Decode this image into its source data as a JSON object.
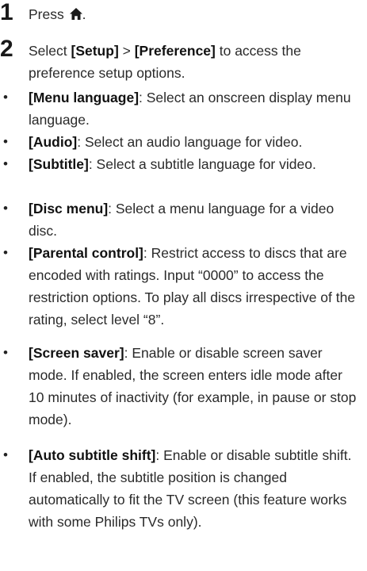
{
  "steps": [
    {
      "number": "1",
      "text": "Press",
      "icon": "home-icon",
      "text_after": "."
    },
    {
      "number": "2",
      "before": "Select ",
      "term1": "[Setup]",
      "middle": " > ",
      "term2": "[Preference]",
      "after": " to access the preference setup options."
    }
  ],
  "bullets": [
    {
      "symbol": "•",
      "term": "[Menu language]",
      "text": ": Select an onscreen display menu language."
    },
    {
      "symbol": "•",
      "term": "[Audio]",
      "text": ": Select an audio language for video."
    },
    {
      "symbol": "•",
      "term": "[Subtitle]",
      "text": ": Select a subtitle language for video."
    },
    {
      "symbol": "•",
      "term": "[Disc menu]",
      "text": ": Select a menu language for a video disc."
    },
    {
      "symbol": "•",
      "term": "[Parental control]",
      "text": ": Restrict access to discs that are encoded with ratings. Input “0000” to access the restriction options. To play all discs irrespective of the rating, select level “8”."
    },
    {
      "symbol": "•",
      "term": "[Screen saver]",
      "text": ": Enable or disable screen saver mode. If enabled, the screen enters idle mode after 10 minutes of inactivity (for example, in pause or stop mode)."
    },
    {
      "symbol": "•",
      "term": "[Auto subtitle shift]",
      "text": ": Enable or disable subtitle shift. If enabled, the subtitle position is changed automatically to fit the TV screen (this feature works with some Philips TVs only)."
    }
  ]
}
